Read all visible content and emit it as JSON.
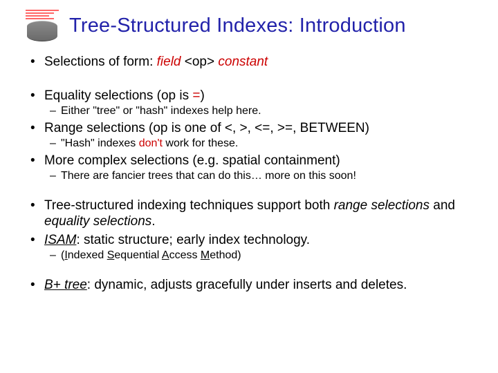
{
  "title": "Tree-Structured Indexes: Introduction",
  "b1": {
    "pre": "Selections of form: ",
    "field": "field",
    "mid": " <op> ",
    "constant": "constant"
  },
  "b2": {
    "pre": "Equality selections (op is ",
    "eq": "=",
    "post": ")",
    "sub": "Either \"tree\" or \"hash\" indexes help here."
  },
  "b3": {
    "text": "Range selections (op is one of <, >, <=, >=, BETWEEN)",
    "sub": {
      "pre": "\"Hash\" indexes ",
      "dont": "don't",
      "post": " work for these."
    }
  },
  "b4": {
    "text": "More complex selections (e.g. spatial containment)",
    "sub": "There are fancier trees that can do this… more on this soon!"
  },
  "b5": {
    "pre": "Tree-structured indexing techniques support both ",
    "rs": "range selections",
    "mid": " and ",
    "es": "equality selections",
    "post": "."
  },
  "b6": {
    "isam": "ISAM",
    "post": ":  static structure; early index technology.",
    "sub": {
      "open": "(",
      "i": "I",
      "ndexed": "ndexed ",
      "s": "S",
      "eq": "equential ",
      "a": "A",
      "ccess": "ccess ",
      "m": "M",
      "ethod": "ethod)"
    }
  },
  "b7": {
    "bp": "B+ tree",
    "post": ":  dynamic, adjusts gracefully under inserts and deletes."
  }
}
